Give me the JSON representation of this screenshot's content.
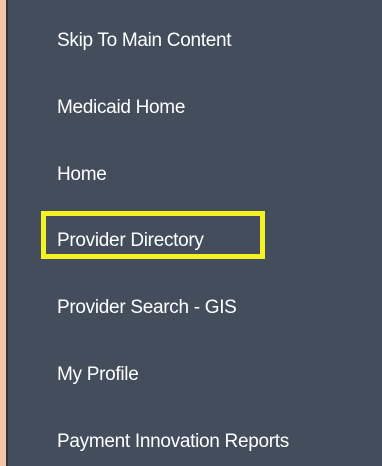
{
  "nav": {
    "items": [
      {
        "label": "Skip To Main Content"
      },
      {
        "label": "Medicaid Home"
      },
      {
        "label": "Home"
      },
      {
        "label": "Provider Directory"
      },
      {
        "label": "Provider Search - GIS"
      },
      {
        "label": "My Profile"
      },
      {
        "label": "Payment Innovation Reports"
      }
    ],
    "highlighted_index": 3
  },
  "colors": {
    "page_background": "#f5c6a5",
    "panel_background": "#434d5c",
    "text": "#ffffff",
    "highlight": "#f2f224"
  }
}
